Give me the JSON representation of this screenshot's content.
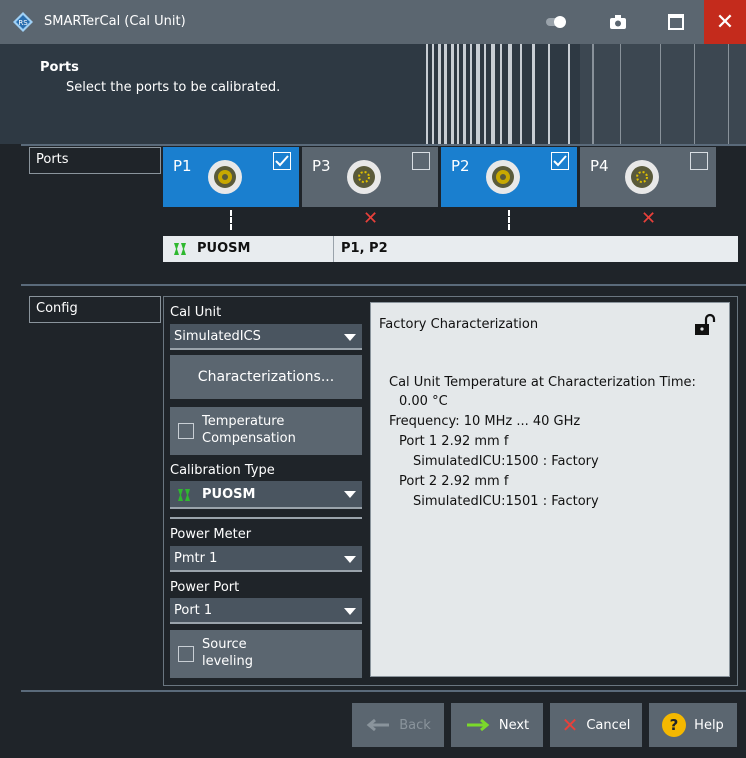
{
  "window": {
    "title": "SMARTerCal (Cal Unit)"
  },
  "header": {
    "title": "Ports",
    "subtitle": "Select the ports to be calibrated."
  },
  "ports_section": {
    "label": "Ports",
    "ports": [
      {
        "name": "P1",
        "selected": true
      },
      {
        "name": "P3",
        "selected": false
      },
      {
        "name": "P2",
        "selected": true
      },
      {
        "name": "P4",
        "selected": false
      }
    ],
    "cal_row": {
      "type": "PUOSM",
      "ports": "P1, P2"
    }
  },
  "config_section": {
    "label": "Config",
    "cal_unit_label": "Cal Unit",
    "cal_unit_value": "SimulatedICS",
    "characterizations_button": "Characterizations...",
    "temp_comp_label": "Temperature Compensation",
    "temp_comp_line1": "Temperature",
    "temp_comp_line2": "Compensation",
    "calibration_type_label": "Calibration Type",
    "calibration_type_value": "PUOSM",
    "power_meter_label": "Power Meter",
    "power_meter_value": "Pmtr 1",
    "power_port_label": "Power Port",
    "power_port_value": "Port 1",
    "source_leveling_line1": "Source",
    "source_leveling_line2": "leveling"
  },
  "factory": {
    "title": "Factory Characterization",
    "lines": [
      "Cal Unit Temperature at Characterization Time:",
      "0.00 °C",
      "Frequency: 10 MHz ... 40 GHz",
      "Port 1 2.92 mm f",
      "SimulatedICU:1500 : Factory",
      "Port 2 2.92 mm f",
      "SimulatedICU:1501 : Factory"
    ]
  },
  "buttons": {
    "back": "Back",
    "next": "Next",
    "cancel": "Cancel",
    "help": "Help"
  },
  "colors": {
    "accent": "#1a7fcf",
    "close": "#c42b1c",
    "error": "#e8403a",
    "success": "#2fb82f",
    "help": "#f5b800"
  }
}
